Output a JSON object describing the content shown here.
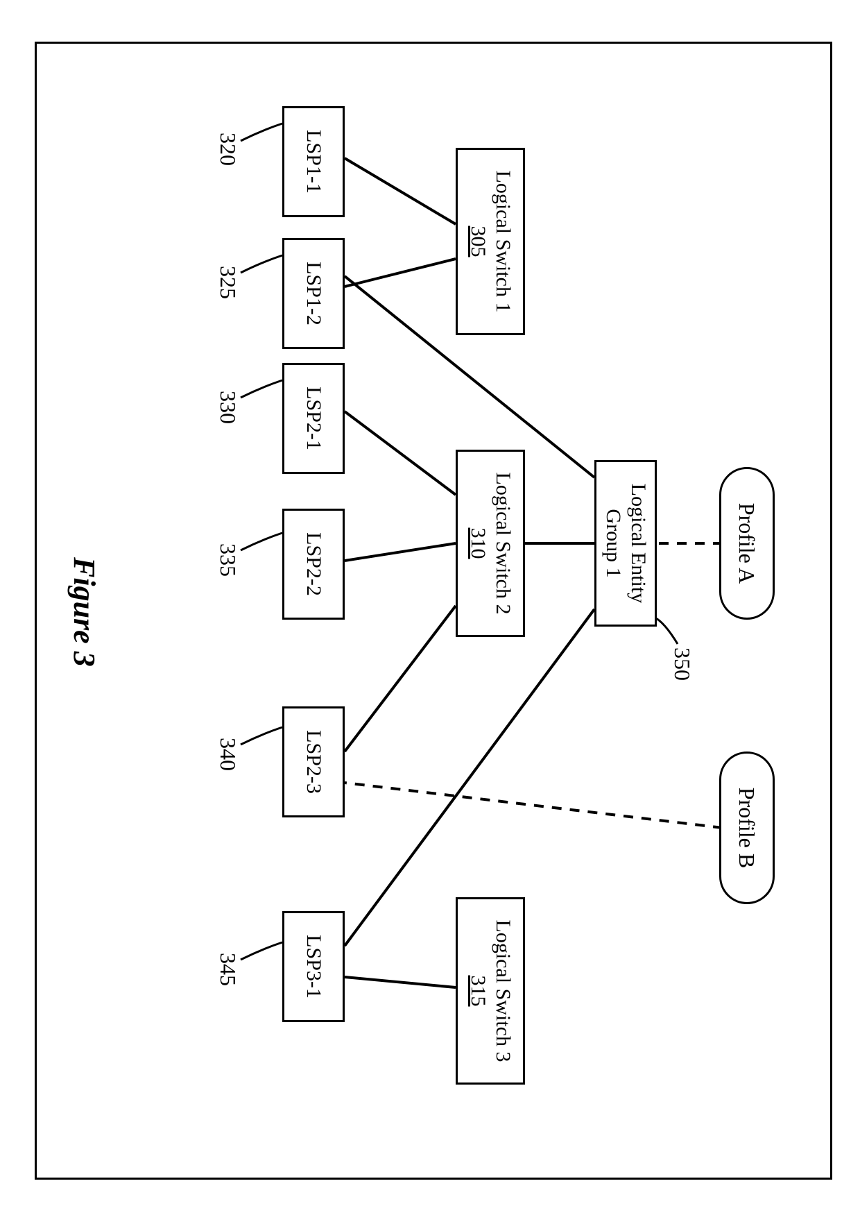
{
  "figure_caption": "Figure 3",
  "profiles": {
    "a": "Profile A",
    "b": "Profile B"
  },
  "group": {
    "line1": "Logical Entity",
    "line2": "Group 1"
  },
  "switches": {
    "s1": {
      "name": "Logical Switch 1",
      "ref": "305"
    },
    "s2": {
      "name": "Logical Switch 2",
      "ref": "310"
    },
    "s3": {
      "name": "Logical Switch 3",
      "ref": "315"
    }
  },
  "ports": {
    "p11": "LSP1-1",
    "p12": "LSP1-2",
    "p21": "LSP2-1",
    "p22": "LSP2-2",
    "p23": "LSP2-3",
    "p31": "LSP3-1"
  },
  "refs": {
    "r320": "320",
    "r325": "325",
    "r330": "330",
    "r335": "335",
    "r340": "340",
    "r345": "345",
    "r350": "350"
  }
}
